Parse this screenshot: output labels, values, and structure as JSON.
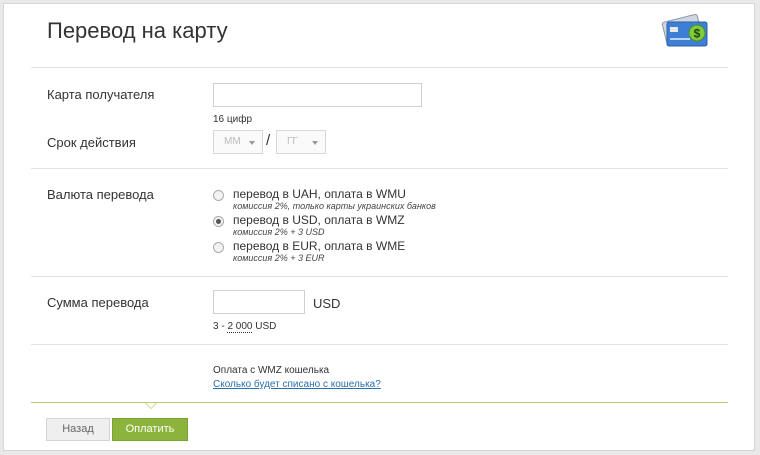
{
  "page": {
    "title": "Перевод на карту",
    "icon": "credit-card-dollar-icon"
  },
  "card": {
    "label": "Карта получателя",
    "value": "",
    "hint": "16 цифр"
  },
  "expiry": {
    "label": "Срок действия",
    "month_placeholder": "ММ",
    "year_placeholder": "ГГ",
    "separator": "/"
  },
  "currency": {
    "label": "Валюта перевода",
    "options": [
      {
        "title": "перевод в UAH, оплата в WMU",
        "sub": "комиссия 2%, только карты украинских банков",
        "checked": false
      },
      {
        "title": "перевод в USD, оплата в WMZ",
        "sub": "комиссия 2% + 3 USD",
        "checked": true
      },
      {
        "title": "перевод в EUR, оплата в WME",
        "sub": "комиссия 2% + 3 EUR",
        "checked": false
      }
    ]
  },
  "amount": {
    "label": "Сумма перевода",
    "value": "",
    "unit": "USD",
    "range_min": "3",
    "range_dash": " - ",
    "range_max": "2 000",
    "range_unit": "USD"
  },
  "payment": {
    "wallet_text": "Оплата с WMZ кошелька",
    "link_text": "Сколько будет списано с кошелька?"
  },
  "buttons": {
    "back": "Назад",
    "pay": "Оплатить"
  },
  "colors": {
    "accent": "#8cb43c",
    "link": "#2a6fb0",
    "card_icon": "#3d7fd6"
  }
}
